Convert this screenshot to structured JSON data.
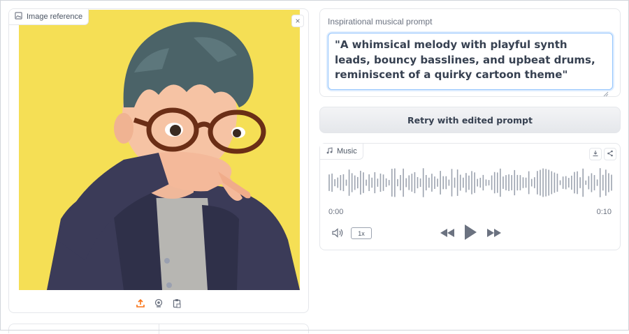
{
  "image_panel": {
    "label": "Image reference",
    "close_glyph": "×",
    "toolbar": [
      "upload-icon",
      "webcam-icon",
      "clipboard-icon"
    ],
    "accent_color": "#f97316",
    "background_color": "#f5df55"
  },
  "prompt": {
    "label": "Inspirational musical prompt",
    "value": "\"A whimsical melody with playful synth leads, bouncy basslines, and upbeat drums, reminiscent of a quirky cartoon theme\""
  },
  "retry_button": {
    "label": "Retry with edited prompt"
  },
  "music": {
    "label": "Music",
    "time_start": "0:00",
    "time_end": "0:10",
    "speed": "1x",
    "icons": [
      "music-note-icon",
      "download-icon",
      "share-icon",
      "volume-icon",
      "rewind-icon",
      "play-icon",
      "fast-forward-icon"
    ]
  }
}
